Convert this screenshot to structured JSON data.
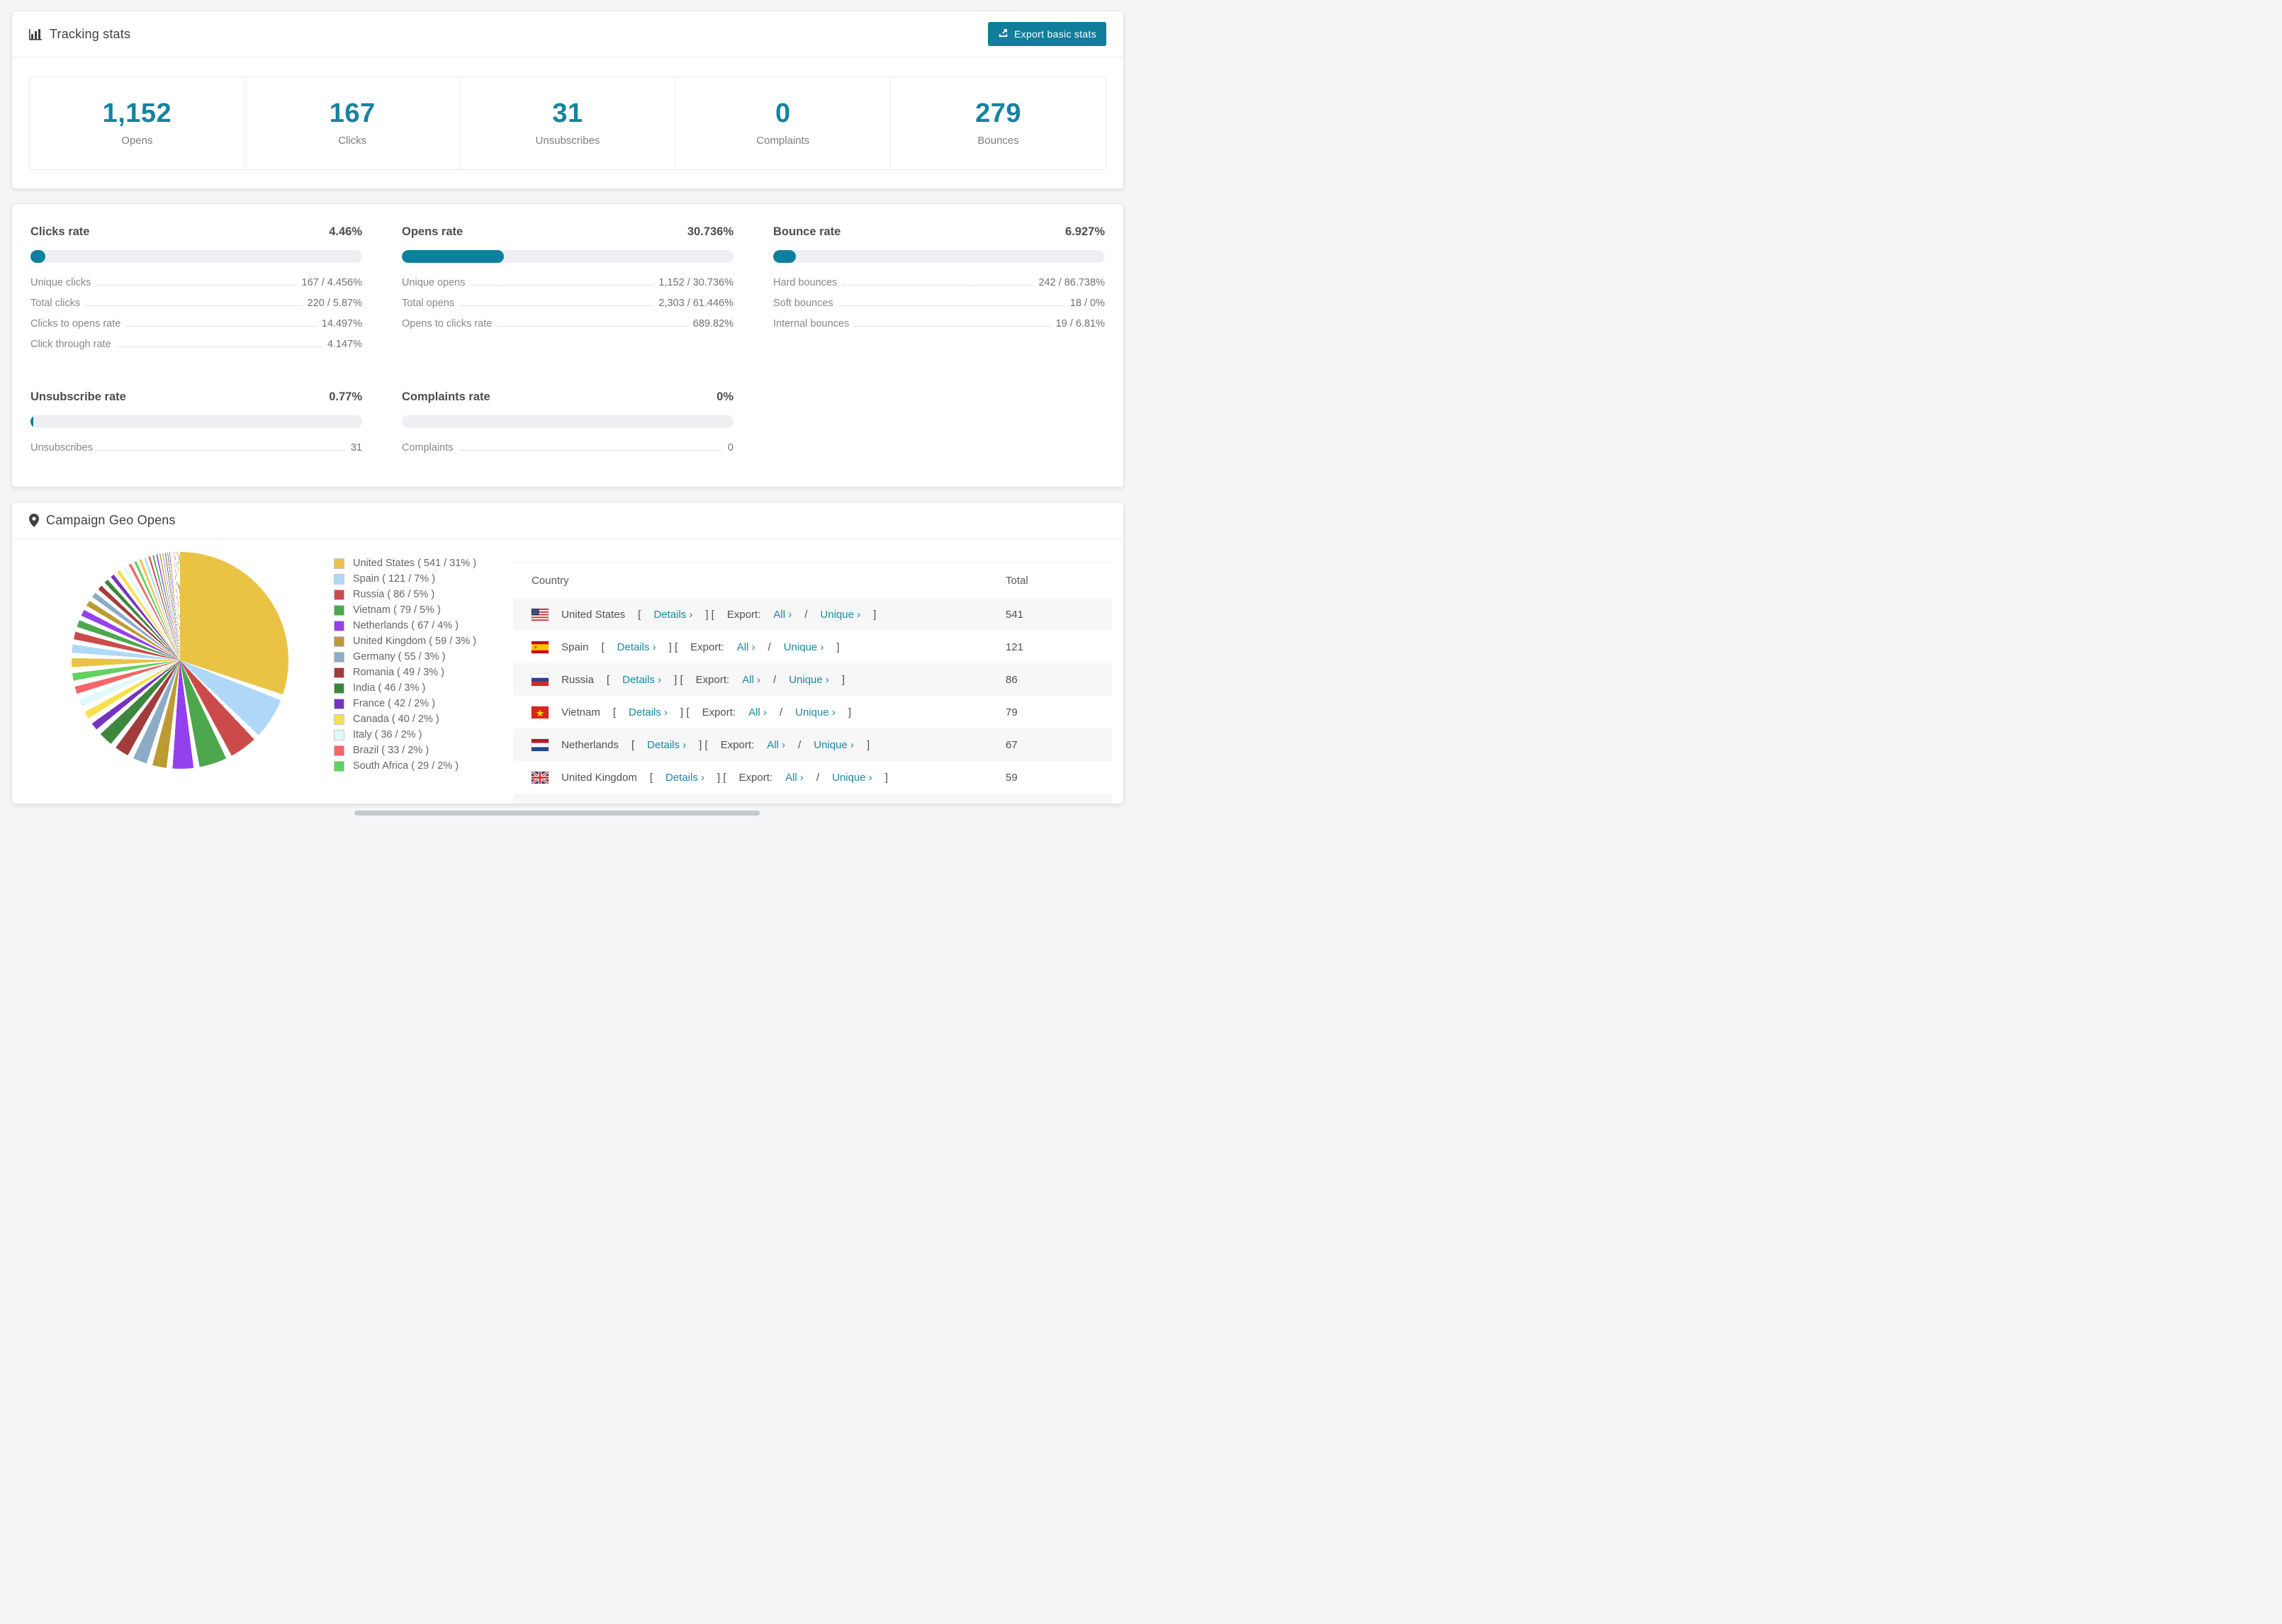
{
  "accent_color": "#117e9c",
  "header": {
    "title": "Tracking stats",
    "export_button": "Export basic stats"
  },
  "summary_stats": [
    {
      "value": "1,152",
      "label": "Opens"
    },
    {
      "value": "167",
      "label": "Clicks"
    },
    {
      "value": "31",
      "label": "Unsubscribes"
    },
    {
      "value": "0",
      "label": "Complaints"
    },
    {
      "value": "279",
      "label": "Bounces"
    }
  ],
  "rate_panels": [
    {
      "title": "Clicks rate",
      "percent_label": "4.46%",
      "bar_percent": 4.46,
      "rows": [
        {
          "label": "Unique clicks",
          "value": "167 / 4.456%"
        },
        {
          "label": "Total clicks",
          "value": "220 / 5.87%"
        },
        {
          "label": "Clicks to opens rate",
          "value": "14.497%"
        },
        {
          "label": "Click through rate",
          "value": "4.147%"
        }
      ]
    },
    {
      "title": "Opens rate",
      "percent_label": "30.736%",
      "bar_percent": 30.736,
      "rows": [
        {
          "label": "Unique opens",
          "value": "1,152 / 30.736%"
        },
        {
          "label": "Total opens",
          "value": "2,303 / 61.446%"
        },
        {
          "label": "Opens to clicks rate",
          "value": "689.82%"
        }
      ]
    },
    {
      "title": "Bounce rate",
      "percent_label": "6.927%",
      "bar_percent": 6.927,
      "rows": [
        {
          "label": "Hard bounces",
          "value": "242 / 86.738%"
        },
        {
          "label": "Soft bounces",
          "value": "18 / 0%"
        },
        {
          "label": "Internal bounces",
          "value": "19 / 6.81%"
        }
      ]
    },
    {
      "title": "Unsubscribe rate",
      "percent_label": "0.77%",
      "bar_percent": 0.77,
      "rows": [
        {
          "label": "Unsubscribes",
          "value": "31"
        }
      ]
    },
    {
      "title": "Complaints rate",
      "percent_label": "0%",
      "bar_percent": 0,
      "rows": [
        {
          "label": "Complaints",
          "value": "0"
        }
      ]
    }
  ],
  "geo": {
    "title": "Campaign Geo Opens",
    "links": {
      "details": "Details",
      "export_prefix": "Export:",
      "all": "All",
      "unique": "Unique",
      "chevron": "›"
    },
    "table": {
      "headers": {
        "country": "Country",
        "total": "Total"
      },
      "rows": [
        {
          "country": "United States",
          "flag": "us",
          "total": "541"
        },
        {
          "country": "Spain",
          "flag": "es",
          "total": "121"
        },
        {
          "country": "Russia",
          "flag": "ru",
          "total": "86"
        },
        {
          "country": "Vietnam",
          "flag": "vn",
          "total": "79"
        },
        {
          "country": "Netherlands",
          "flag": "nl",
          "total": "67"
        },
        {
          "country": "United Kingdom",
          "flag": "gb",
          "total": "59"
        },
        {
          "country": "",
          "flag": "de",
          "total": "",
          "partial": true
        }
      ]
    }
  },
  "chart_data": {
    "type": "pie",
    "title": "Campaign Geo Opens",
    "unit": "opens",
    "start_angle_deg": 0,
    "direction": "clockwise",
    "legend_position": "right",
    "slices": [
      {
        "label": "United States",
        "opens": 541,
        "percent": 31,
        "color": "#EAC344"
      },
      {
        "label": "Spain",
        "opens": 121,
        "percent": 7,
        "color": "#AFD8F8"
      },
      {
        "label": "Russia",
        "opens": 86,
        "percent": 5,
        "color": "#CB4B4B"
      },
      {
        "label": "Vietnam",
        "opens": 79,
        "percent": 5,
        "color": "#4DA74D"
      },
      {
        "label": "Netherlands",
        "opens": 67,
        "percent": 4,
        "color": "#9440ED"
      },
      {
        "label": "United Kingdom",
        "opens": 59,
        "percent": 3,
        "color": "#BD9B33"
      },
      {
        "label": "Germany",
        "opens": 55,
        "percent": 3,
        "color": "#8CACC6"
      },
      {
        "label": "Romania",
        "opens": 49,
        "percent": 3,
        "color": "#A23C3C"
      },
      {
        "label": "India",
        "opens": 46,
        "percent": 3,
        "color": "#3D863D"
      },
      {
        "label": "France",
        "opens": 42,
        "percent": 2,
        "color": "#7633BD"
      },
      {
        "label": "Canada",
        "opens": 40,
        "percent": 2,
        "color": "#F9E04B"
      },
      {
        "label": "Italy",
        "opens": 36,
        "percent": 2,
        "color": "#DFF9F9"
      },
      {
        "label": "Brazil",
        "opens": 33,
        "percent": 2,
        "color": "#F56666"
      },
      {
        "label": "South Africa",
        "opens": 29,
        "percent": 2,
        "color": "#61D161"
      }
    ],
    "others_unlabeled_percent": 26
  }
}
